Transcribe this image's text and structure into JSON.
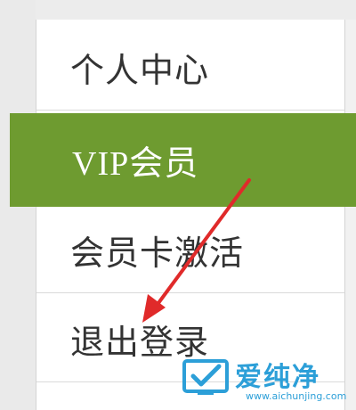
{
  "menu": {
    "items": [
      {
        "label": "个人中心",
        "active": false
      },
      {
        "label": "VIP会员",
        "active": true
      },
      {
        "label": "会员卡激活",
        "active": false
      },
      {
        "label": "退出登录",
        "active": false
      }
    ]
  },
  "annotation": {
    "arrow_color": "#e02a2a",
    "target": "退出登录"
  },
  "watermark": {
    "title": "爱纯净",
    "url": "www.aichunjing.com",
    "color": "#2c9fd8"
  },
  "colors": {
    "active_bg": "#6e9b30",
    "text": "#333333",
    "active_text": "#ffffff"
  }
}
